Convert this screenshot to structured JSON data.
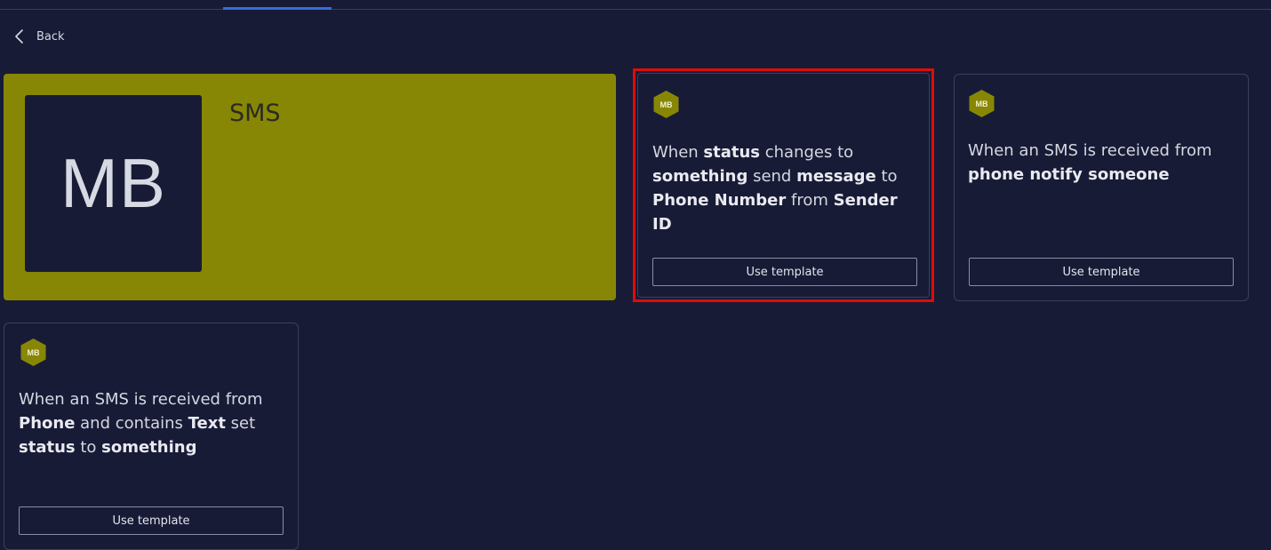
{
  "nav": {
    "back_label": "Back"
  },
  "hero": {
    "logo_text": "MB",
    "title": "SMS",
    "color": "#878705"
  },
  "cards": [
    {
      "badge": "MB",
      "segments": [
        {
          "text": "When ",
          "bold": false
        },
        {
          "text": "status",
          "bold": true
        },
        {
          "text": " changes to ",
          "bold": false
        },
        {
          "text": "something",
          "bold": true
        },
        {
          "text": " send ",
          "bold": false
        },
        {
          "text": "message",
          "bold": true
        },
        {
          "text": " to ",
          "bold": false
        },
        {
          "text": "Phone Number",
          "bold": true
        },
        {
          "text": " from ",
          "bold": false
        },
        {
          "text": "Sender ID",
          "bold": true
        }
      ],
      "button_label": "Use template",
      "highlighted": true
    },
    {
      "badge": "MB",
      "segments": [
        {
          "text": "When an SMS is received from ",
          "bold": false
        },
        {
          "text": "phone notify someone",
          "bold": true
        }
      ],
      "button_label": "Use template",
      "highlighted": false
    },
    {
      "badge": "MB",
      "segments": [
        {
          "text": "When an SMS is received from ",
          "bold": false
        },
        {
          "text": "Phone",
          "bold": true
        },
        {
          "text": " and contains ",
          "bold": false
        },
        {
          "text": "Text",
          "bold": true
        },
        {
          "text": " set ",
          "bold": false
        },
        {
          "text": "status",
          "bold": true
        },
        {
          "text": " to ",
          "bold": false
        },
        {
          "text": "something",
          "bold": true
        }
      ],
      "button_label": "Use template",
      "highlighted": false
    }
  ],
  "colors": {
    "background": "#181b36",
    "accent": "#878705",
    "highlight": "#e00b0b",
    "tab_indicator": "#2f6fe0"
  }
}
